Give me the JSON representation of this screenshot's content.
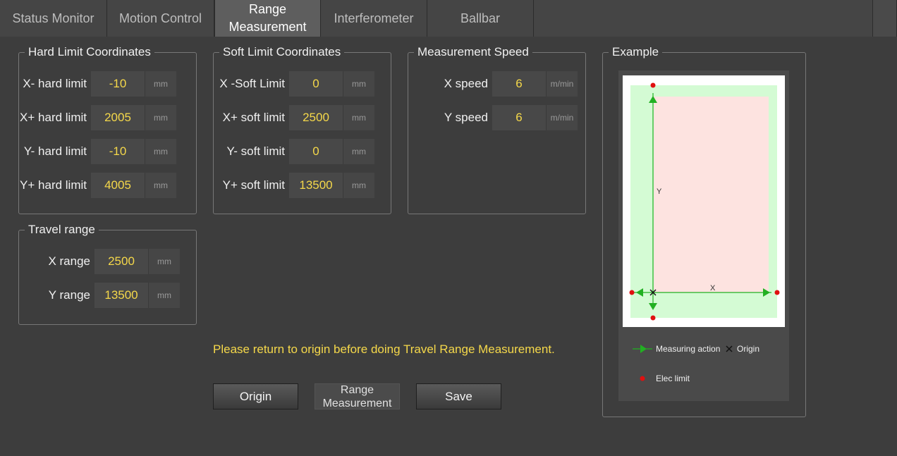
{
  "tabs": [
    {
      "label": "Status Monitor",
      "active": false
    },
    {
      "label": "Motion Control",
      "active": false
    },
    {
      "label": "Range\nMeasurement",
      "active": true
    },
    {
      "label": "Interferometer",
      "active": false
    },
    {
      "label": "Ballbar",
      "active": false
    }
  ],
  "hard_limit": {
    "title": "Hard Limit Coordinates",
    "rows": [
      {
        "label": "X- hard limit",
        "value": "-10",
        "unit": "mm"
      },
      {
        "label": "X+ hard limit",
        "value": "2005",
        "unit": "mm"
      },
      {
        "label": "Y- hard limit",
        "value": "-10",
        "unit": "mm"
      },
      {
        "label": "Y+ hard limit",
        "value": "4005",
        "unit": "mm"
      }
    ]
  },
  "soft_limit": {
    "title": "Soft Limit Coordinates",
    "rows": [
      {
        "label": "X -Soft Limit",
        "value": "0",
        "unit": "mm"
      },
      {
        "label": "X+ soft limit",
        "value": "2500",
        "unit": "mm"
      },
      {
        "label": "Y- soft limit",
        "value": "0",
        "unit": "mm"
      },
      {
        "label": "Y+ soft limit",
        "value": "13500",
        "unit": "mm"
      }
    ]
  },
  "speed": {
    "title": "Measurement Speed",
    "rows": [
      {
        "label": "X speed",
        "value": "6",
        "unit": "m/min"
      },
      {
        "label": "Y speed",
        "value": "6",
        "unit": "m/min"
      }
    ]
  },
  "travel": {
    "title": "Travel range",
    "rows": [
      {
        "label": "X range",
        "value": "2500",
        "unit": "mm"
      },
      {
        "label": "Y range",
        "value": "13500",
        "unit": "mm"
      }
    ]
  },
  "example": {
    "title": "Example",
    "axis_y": "Y",
    "axis_x": "X",
    "legend_measuring": "Measuring action",
    "legend_origin": "Origin",
    "legend_elec": "Elec limit"
  },
  "notice": "Please return to origin before doing Travel Range Measurement.",
  "buttons": {
    "origin": "Origin",
    "range": "Range\nMeasurement",
    "save": "Save"
  },
  "colors": {
    "value_text": "#f5d84a",
    "safe_zone": "#d4fbd4",
    "work_zone": "#fde3e0",
    "axis_arrow": "#22b022",
    "limit_dot": "#e01010"
  }
}
